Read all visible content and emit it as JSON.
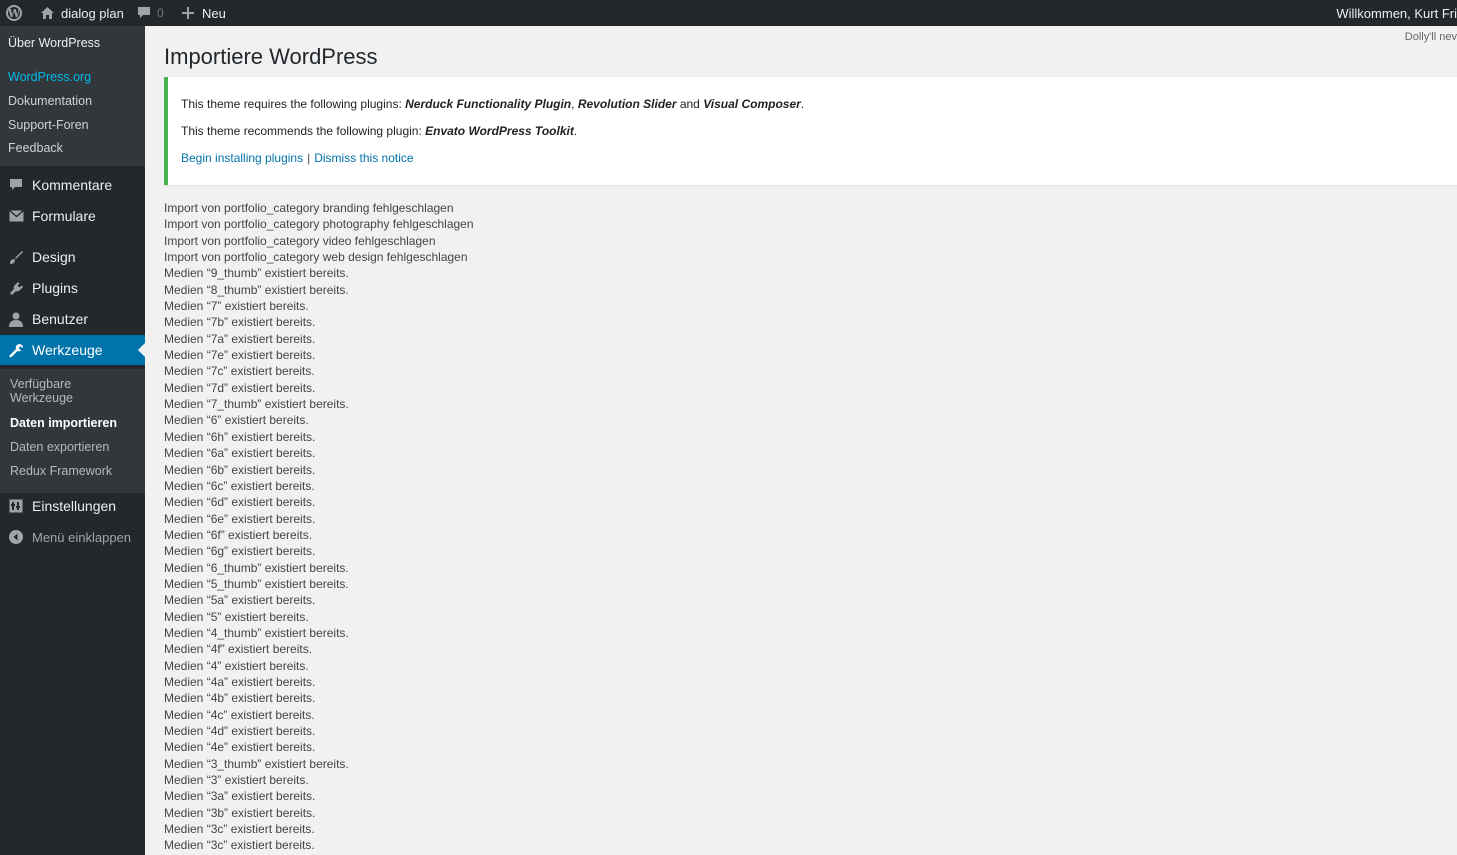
{
  "admin_bar": {
    "site_name": "dialog plan",
    "comments_count": "0",
    "new_label": "Neu",
    "welcome": "Willkommen, Kurt Fri"
  },
  "sidebar": {
    "submenu": [
      "Über WordPress",
      "WordPress.org",
      "Dokumentation",
      "Support-Foren",
      "Feedback"
    ],
    "menu": {
      "kommentare": "Kommentare",
      "formulare": "Formulare",
      "design": "Design",
      "plugins": "Plugins",
      "benutzer": "Benutzer",
      "werkzeuge": "Werkzeuge",
      "einstellungen": "Einstellungen",
      "collapse": "Menü einklappen"
    },
    "tools_submenu": {
      "available": "Verfügbare Werkzeuge",
      "import": "Daten importieren",
      "export": "Daten exportieren",
      "redux": "Redux Framework"
    }
  },
  "content": {
    "dolly": "Dolly'll nev",
    "title": "Importiere WordPress",
    "notice": {
      "line1_prefix": "This theme requires the following plugins: ",
      "plugin1": "Nerduck Functionality Plugin",
      "comma": ", ",
      "plugin2": "Revolution Slider",
      "and": " and ",
      "plugin3": "Visual Composer",
      "period": ".",
      "line2_prefix": "This theme recommends the following plugin: ",
      "plugin4": "Envato WordPress Toolkit",
      "begin_link": "Begin installing plugins",
      "separator": "|",
      "dismiss_link": "Dismiss this notice"
    },
    "log_lines": [
      "Import von portfolio_category branding fehlgeschlagen",
      "Import von portfolio_category photography fehlgeschlagen",
      "Import von portfolio_category video fehlgeschlagen",
      "Import von portfolio_category web design fehlgeschlagen",
      "Medien “9_thumb” existiert bereits.",
      "Medien “8_thumb” existiert bereits.",
      "Medien “7” existiert bereits.",
      "Medien “7b” existiert bereits.",
      "Medien “7a” existiert bereits.",
      "Medien “7e” existiert bereits.",
      "Medien “7c” existiert bereits.",
      "Medien “7d” existiert bereits.",
      "Medien “7_thumb” existiert bereits.",
      "Medien “6” existiert bereits.",
      "Medien “6h” existiert bereits.",
      "Medien “6a” existiert bereits.",
      "Medien “6b” existiert bereits.",
      "Medien “6c” existiert bereits.",
      "Medien “6d” existiert bereits.",
      "Medien “6e” existiert bereits.",
      "Medien “6f” existiert bereits.",
      "Medien “6g” existiert bereits.",
      "Medien “6_thumb” existiert bereits.",
      "Medien “5_thumb” existiert bereits.",
      "Medien “5a” existiert bereits.",
      "Medien “5” existiert bereits.",
      "Medien “4_thumb” existiert bereits.",
      "Medien “4f” existiert bereits.",
      "Medien “4” existiert bereits.",
      "Medien “4a” existiert bereits.",
      "Medien “4b” existiert bereits.",
      "Medien “4c” existiert bereits.",
      "Medien “4d” existiert bereits.",
      "Medien “4e” existiert bereits.",
      "Medien “3_thumb” existiert bereits.",
      "Medien “3” existiert bereits.",
      "Medien “3a” existiert bereits.",
      "Medien “3b” existiert bereits.",
      "Medien “3c” existiert bereits.",
      "Medien “3c” existiert bereits."
    ]
  },
  "colors": {
    "admin_bar_bg": "#23282d",
    "sidebar_bg": "#23282d",
    "submenu_bg": "#32373c",
    "accent": "#0073aa",
    "link_active": "#00b9eb",
    "notice_border": "#46b450",
    "content_bg": "#f1f1f1"
  },
  "icons": [
    "wordpress-logo-icon",
    "home-icon",
    "comment-icon",
    "plus-icon",
    "envelope-icon",
    "brush-icon",
    "plug-icon",
    "user-icon",
    "wrench-icon",
    "settings-icon",
    "collapse-arrow-icon"
  ]
}
